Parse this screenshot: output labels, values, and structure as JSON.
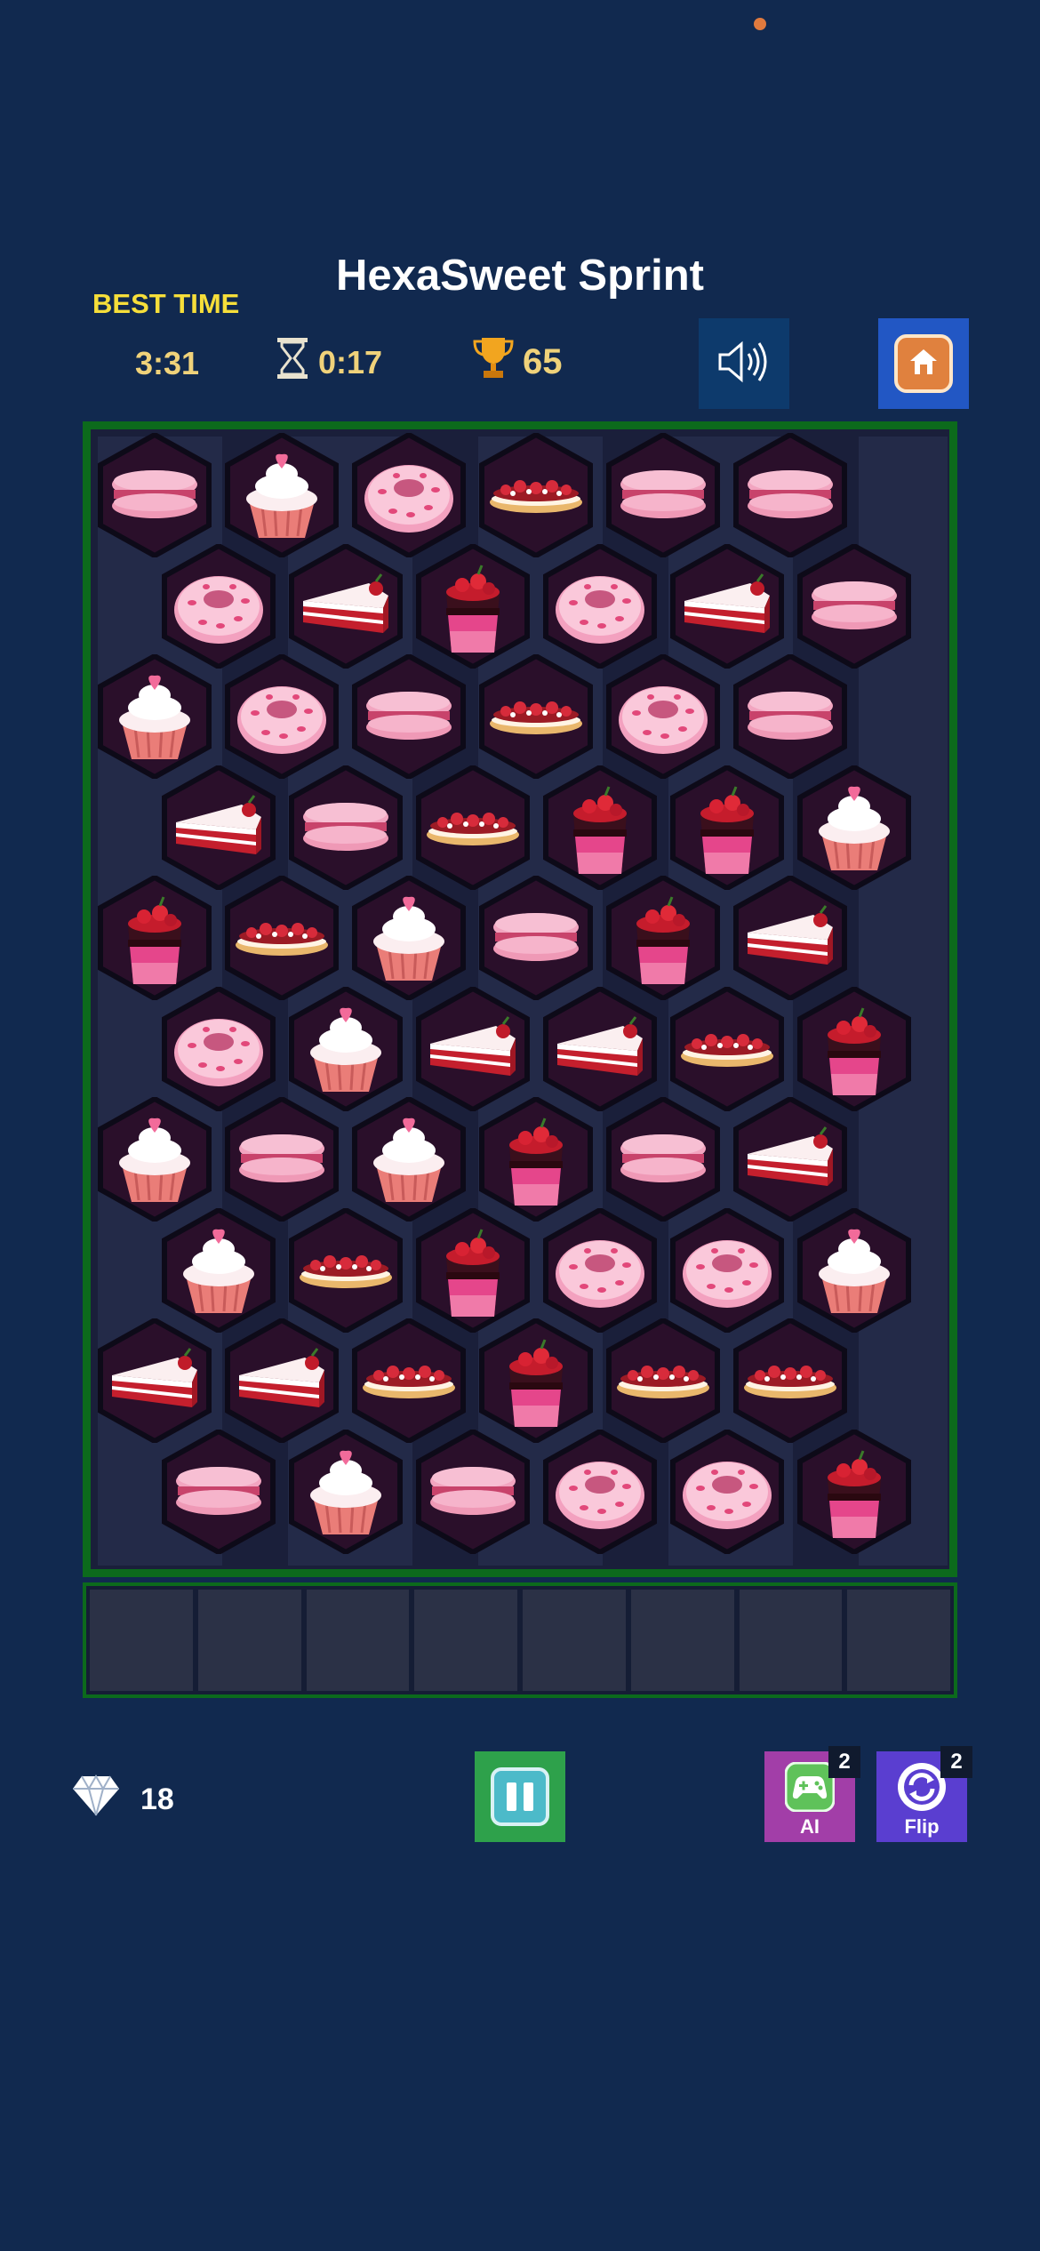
{
  "game": {
    "title": "HexaSweet Sprint",
    "best_time_label": "BEST TIME",
    "best_time_value": "3:31",
    "timer_value": "0:17",
    "score": "65"
  },
  "icons": {
    "timer": "hourglass-icon",
    "score": "trophy-icon",
    "sound": "speaker-icon",
    "home": "home-icon",
    "gems": "diamond-icon",
    "pause": "pause-icon",
    "ai": "gamepad-icon",
    "flip": "refresh-icon"
  },
  "colors": {
    "background": "#11294f",
    "board_border": "#0c6a1c",
    "accent_yellow": "#f6de3a",
    "home_button": "#2257c4",
    "pause_button": "#2ea14b",
    "ai_button": "#a23ea8",
    "flip_button": "#5a3ed0"
  },
  "board": {
    "rows": [
      [
        "macaron",
        "cupcake",
        "donut",
        "eclair",
        "macaron",
        "macaron"
      ],
      [
        "donut",
        "cake",
        "parfait",
        "donut",
        "cake",
        "macaron"
      ],
      [
        "cupcake",
        "donut",
        "macaron",
        "eclair",
        "donut",
        "macaron"
      ],
      [
        "cake",
        "macaron",
        "eclair",
        "parfait",
        "parfait",
        "cupcake"
      ],
      [
        "parfait",
        "eclair",
        "cupcake",
        "macaron",
        "parfait",
        "cake"
      ],
      [
        "donut",
        "cupcake",
        "cake",
        "cake",
        "eclair",
        "parfait"
      ],
      [
        "cupcake",
        "macaron",
        "cupcake",
        "parfait",
        "macaron",
        "cake"
      ],
      [
        "cupcake",
        "eclair",
        "parfait",
        "donut",
        "donut",
        "cupcake"
      ],
      [
        "cake",
        "cake",
        "eclair",
        "parfait",
        "eclair",
        "eclair"
      ],
      [
        "macaron",
        "cupcake",
        "macaron",
        "donut",
        "donut",
        "parfait"
      ]
    ]
  },
  "tray": {
    "slots": 8,
    "filled": 0
  },
  "footer": {
    "gems_count": "18",
    "ai_label": "AI",
    "ai_count": "2",
    "flip_label": "Flip",
    "flip_count": "2"
  }
}
